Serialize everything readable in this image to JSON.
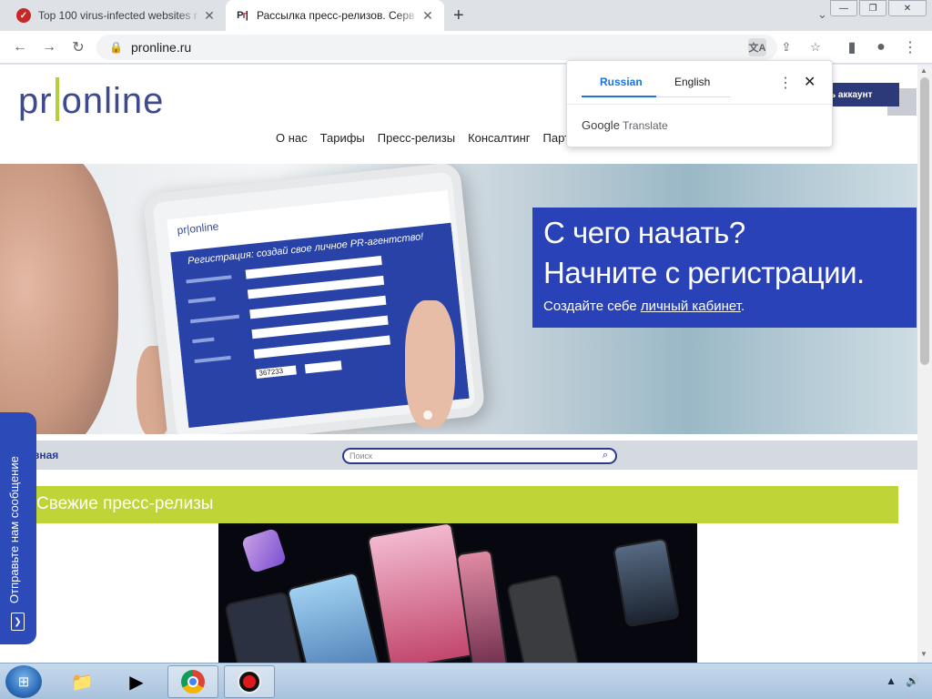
{
  "browser": {
    "tabs": [
      {
        "title": "Top 100 virus-infected websites r",
        "favicon": "virus-site-favicon",
        "active": false
      },
      {
        "title": "Рассылка пресс-релизов. Серв",
        "favicon": "pronline-favicon",
        "active": true
      }
    ],
    "new_tab": "+",
    "url": "pronline.ru"
  },
  "site": {
    "logo": {
      "left": "pr",
      "right": "online"
    },
    "nav": [
      "О нас",
      "Тарифы",
      "Пресс-релизы",
      "Консалтинг",
      "Парт"
    ],
    "account_button": "ь аккаунт",
    "hero": {
      "headline_1": "С чего начать?",
      "headline_2": "Начните с регистрации.",
      "sub_prefix": "Создайте себе ",
      "sub_link": "личный кабинет",
      "sub_suffix": "."
    },
    "tablet": {
      "title": "Регистрация: создай свое личное PR-агентство!",
      "captcha": "367233"
    },
    "subnav": {
      "home": "вная",
      "search_placeholder": "Поиск"
    },
    "section_title": "Свежие пресс-релизы",
    "feedback": "Отправьте нам сообщение"
  },
  "translate_popup": {
    "tabs": [
      "Russian",
      "English"
    ],
    "active_tab": "Russian",
    "brand": "Google",
    "product": "Translate"
  },
  "colors": {
    "brand_blue": "#2a42b8",
    "brand_green": "#bed437",
    "logo_color": "#3d4a8f",
    "chrome_accent": "#1a73e8"
  }
}
